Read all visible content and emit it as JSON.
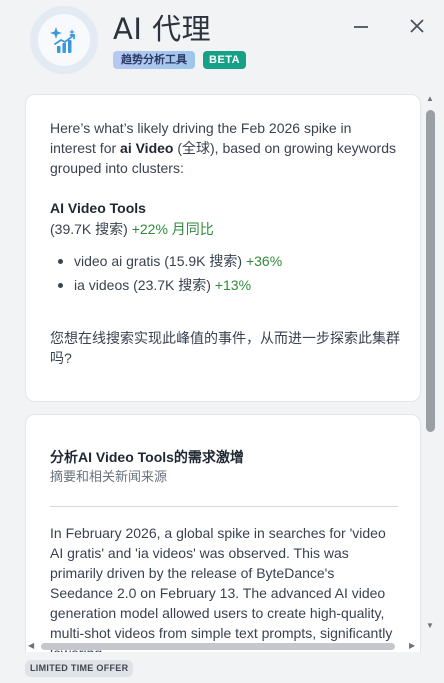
{
  "header": {
    "title": "AI 代理",
    "badge_trend": "趋势分析工具",
    "badge_beta": "BETA"
  },
  "card1": {
    "intro_prefix": "Here’s what’s likely driving the Feb 2026 spike in interest for ",
    "intro_keyword": "ai Video",
    "intro_suffix": " (全球), based on growing keywords grouped into clusters:",
    "cluster_title": "AI Video Tools",
    "cluster_searches": "(39.7K 搜索) ",
    "cluster_growth": "+22% 月同比",
    "keywords": [
      {
        "text": "video ai gratis (15.9K 搜索) ",
        "growth": "+36%"
      },
      {
        "text": "ia videos (23.7K 搜索) ",
        "growth": "+13%"
      }
    ],
    "question": "您想在线搜索实现此峰值的事件，从而进一步探索此集群吗?"
  },
  "card2": {
    "title": "分析AI Video Tools的需求激增",
    "subtitle": "摘要和相关新闻来源",
    "article": "In February 2026, a global spike in searches for 'video AI gratis' and 'ia videos' was observed. This was primarily driven by the release of ByteDance's Seedance 2.0 on February 13. The advanced AI video generation model allowed users to create high-quality, multi-shot videos from simple text prompts, significantly lowering"
  },
  "footer": {
    "offer": "LIMITED TIME OFFER"
  },
  "icons": {
    "logo": "sparkle-chart-icon",
    "minimize": "minimize-icon",
    "close": "close-icon"
  },
  "colors": {
    "growth": "#2e8b3a",
    "beta": "#16a085"
  }
}
